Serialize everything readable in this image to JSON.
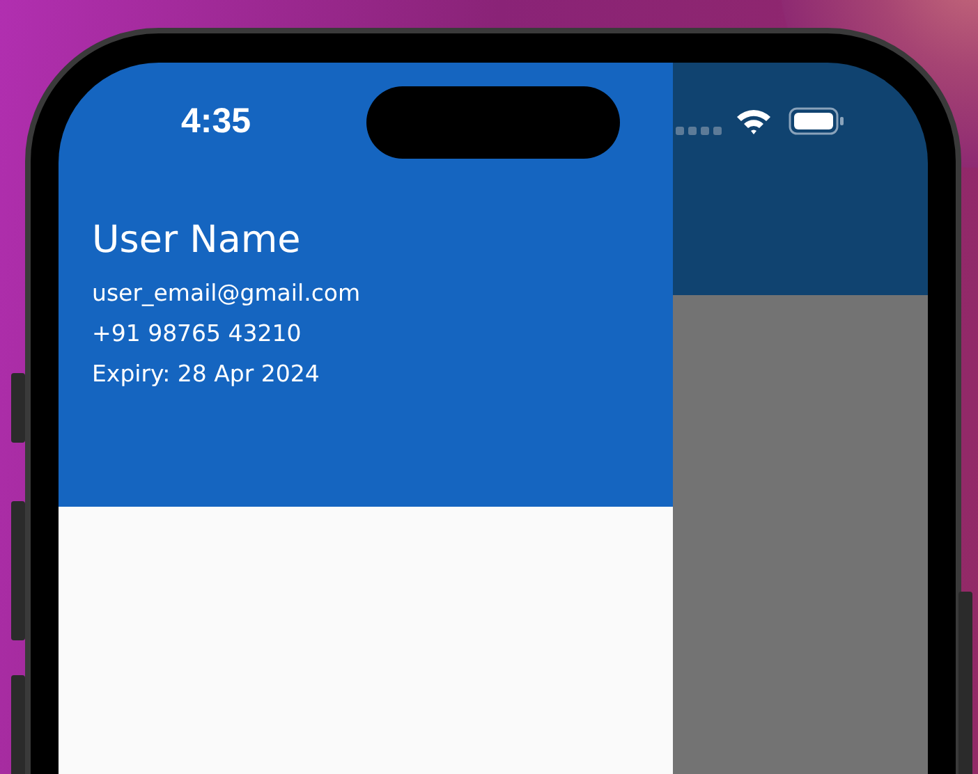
{
  "status_bar": {
    "time": "4:35"
  },
  "drawer": {
    "header": {
      "name": "User Name",
      "lines": [
        "user_email@gmail.com",
        "+91 98765 43210",
        "Expiry: 28 Apr 2024"
      ]
    }
  }
}
